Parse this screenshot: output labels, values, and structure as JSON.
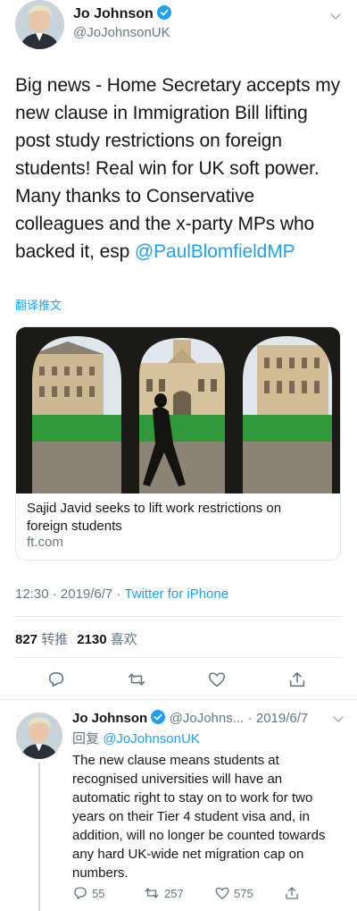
{
  "main_tweet": {
    "author": {
      "name": "Jo Johnson",
      "handle": "@JoJohnsonUK",
      "verified": true
    },
    "text_plain": "Big news - Home Secretary accepts my new clause in Immigration Bill lifting post study restrictions on foreign students! Real win for UK soft power. Many thanks to Conservative colleagues and the x-party MPs who backed it, esp ",
    "text_mention": "@PaulBlomfieldMP",
    "translate_label": "翻译推文",
    "card": {
      "title": "Sajid Javid seeks to lift work restrictions on foreign students",
      "domain": "ft.com"
    },
    "time": "12:30",
    "sep1": "·",
    "date": "2019/6/7",
    "sep2": "·",
    "source": "Twitter for iPhone",
    "retweets_count": "827",
    "retweets_label": "转推",
    "likes_count": "2130",
    "likes_label": "喜欢"
  },
  "reply_tweet": {
    "author": {
      "name": "Jo Johnson",
      "handle": "@JoJohns...",
      "verified": true
    },
    "date": "· 2019/6/7",
    "replying_prefix": "回复",
    "replying_to": "@JoJohnsonUK",
    "text": "The new clause means students at recognised universities will have an automatic right to stay on to work for two years on their Tier 4 student visa and, in addition, will no longer be counted towards any hard UK-wide net migration cap on numbers.",
    "replies": "55",
    "retweets": "257",
    "likes": "575"
  },
  "icons": [
    "verified-badge-icon",
    "chevron-down-icon",
    "reply-icon",
    "retweet-icon",
    "like-icon",
    "share-icon"
  ],
  "colors": {
    "accent": "#1da1f2",
    "text": "#14171a",
    "muted": "#657786",
    "divider": "#e6ecf0"
  }
}
